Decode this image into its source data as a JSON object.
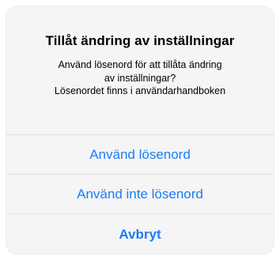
{
  "alert": {
    "title": "Tillåt ändring av inställningar",
    "message_lines": [
      "Använd lösenord för att tillåta ändring",
      "av inställningar?",
      "Lösenordet finns i användarhandboken"
    ],
    "actions": {
      "use_password": "Använd lösenord",
      "dont_use_password": "Använd inte lösenord",
      "cancel": "Avbryt"
    }
  },
  "colors": {
    "accent": "#1a7cf5",
    "background": "#f5f5f6",
    "divider": "#dedee0"
  }
}
